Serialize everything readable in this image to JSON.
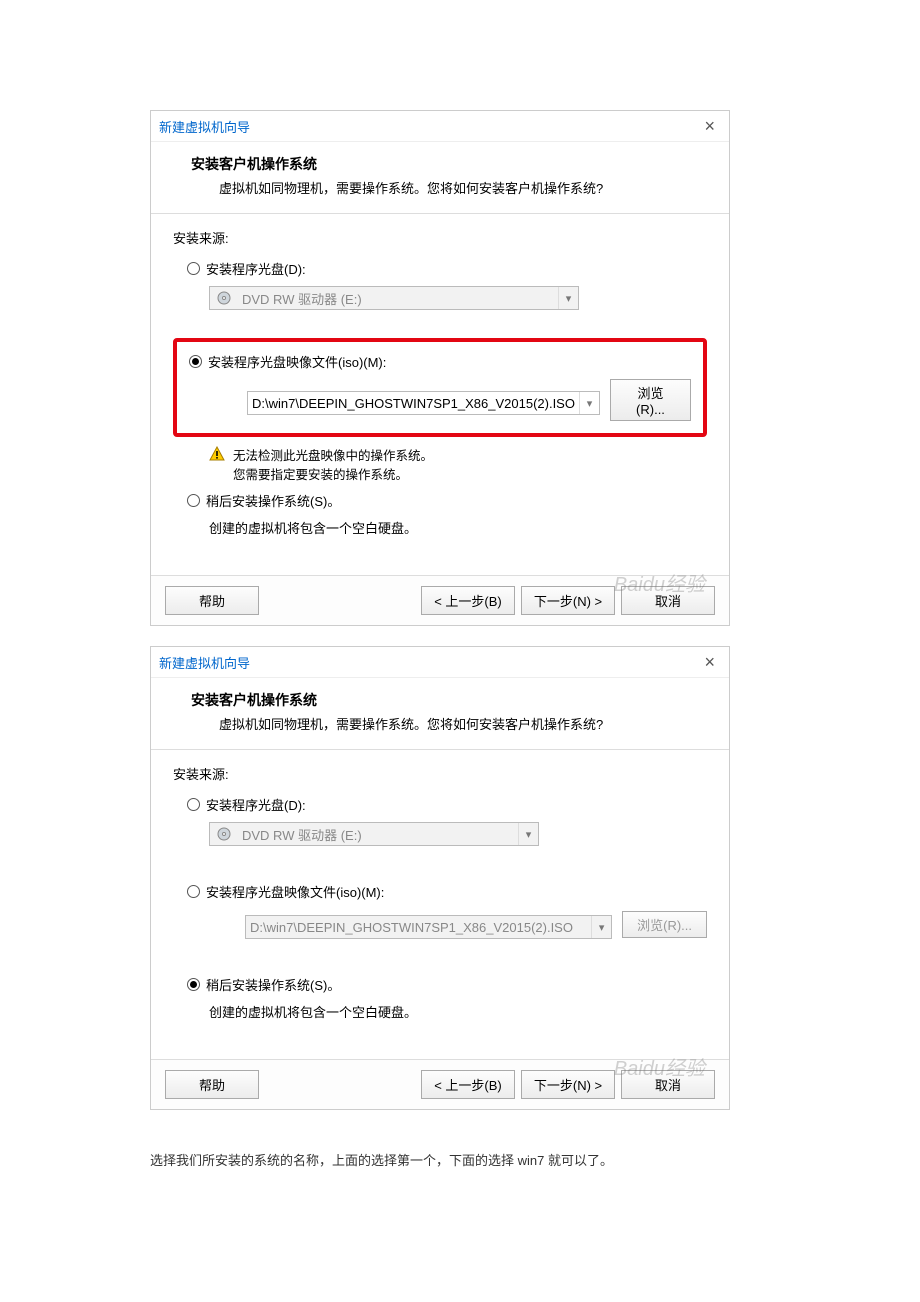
{
  "shared": {
    "window_title": "新建虚拟机向导",
    "header_title": "安装客户机操作系统",
    "header_sub": "虚拟机如同物理机，需要操作系统。您将如何安装客户机操作系统?",
    "source_label": "安装来源:",
    "opt_disc": "安装程序光盘(D):",
    "disc_drive": "DVD RW 驱动器 (E:)",
    "opt_iso": "安装程序光盘映像文件(iso)(M):",
    "iso_path": "D:\\win7\\DEEPIN_GHOSTWIN7SP1_X86_V2015(2).ISO",
    "browse": "浏览(R)...",
    "opt_later": "稍后安装操作系统(S)。",
    "later_note": "创建的虚拟机将包含一个空白硬盘。",
    "help": "帮助",
    "back": "< 上一步(B)",
    "next": "下一步(N) >",
    "cancel": "取消",
    "warn_line1": "无法检测此光盘映像中的操作系统。",
    "warn_line2": "您需要指定要安装的操作系统。",
    "watermark": "Baidu经验"
  },
  "caption": "选择我们所安装的系统的名称，上面的选择第一个，下面的选择 win7 就可以了。"
}
